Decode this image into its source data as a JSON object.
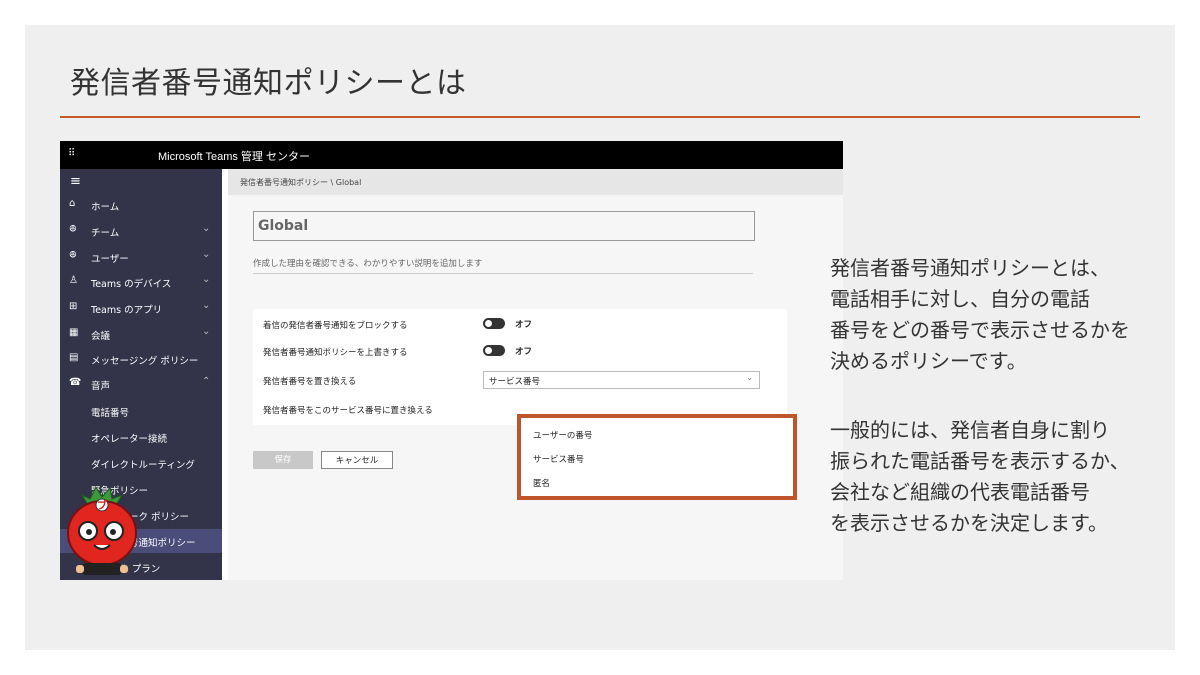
{
  "slide": {
    "title": "発信者番号通知ポリシーとは",
    "paragraph1": [
      "発信者番号通知ポリシーとは、",
      "電話相手に対し、自分の電話",
      "番号をどの番号で表示させるかを",
      "決めるポリシーです。"
    ],
    "paragraph2": [
      "一般的には、発信者自身に割り",
      "振られた電話番号を表示するか、",
      "会社など組織の代表電話番号",
      "を表示させるかを決定します。"
    ]
  },
  "app": {
    "title": "Microsoft Teams 管理 センター",
    "waffle_icon": "⠿",
    "hamburger_icon": "≡"
  },
  "sidebar": {
    "items": [
      {
        "icon": "⌂",
        "label": "ホーム",
        "chevron": ""
      },
      {
        "icon": "ꔮ",
        "label": "チーム",
        "chevron": "⌄"
      },
      {
        "icon": "ꔮ",
        "label": "ユーザー",
        "chevron": "⌄"
      },
      {
        "icon": "♙",
        "label": "Teams のデバイス",
        "chevron": "⌄"
      },
      {
        "icon": "⊞",
        "label": "Teams のアプリ",
        "chevron": "⌄"
      },
      {
        "icon": "▦",
        "label": "会議",
        "chevron": "⌄"
      },
      {
        "icon": "▤",
        "label": "メッセージング ポリシー",
        "chevron": ""
      },
      {
        "icon": "☎",
        "label": "音声",
        "chevron": "⌃"
      }
    ],
    "sub_items": [
      {
        "label": "電話番号"
      },
      {
        "label": "オペレーター接続"
      },
      {
        "label": "ダイレクトルーティング"
      },
      {
        "label": "緊急ポリシー"
      },
      {
        "label": "ネットワーク ポリシー"
      },
      {
        "label": "発信者番号通知ポリシー"
      },
      {
        "label": "ダイヤル プラン"
      }
    ]
  },
  "content": {
    "breadcrumb": "発信者番号通知ポリシー \\ Global",
    "policy_name": "Global",
    "description_placeholder": "作成した理由を確認できる、わかりやすい説明を追加します",
    "settings": [
      {
        "label": "着信の発信者番号通知をブロックする",
        "toggle": "オフ"
      },
      {
        "label": "発信者番号通知ポリシーを上書きする",
        "toggle": "オフ"
      },
      {
        "label": "発信者番号を置き換える",
        "select": "サービス番号"
      },
      {
        "label": "発信者番号をこのサービス番号に置き換える"
      }
    ],
    "dropdown_options": [
      "ユーザーの番号",
      "サービス番号",
      "匿名"
    ],
    "save_label": "保存",
    "cancel_label": "キャンセル"
  },
  "mascot": {
    "badge": "ブ"
  },
  "colors": {
    "accent": "#c55a2b",
    "topbar": "#000000",
    "sidebar": "#33344a",
    "slide_bg": "#efefef"
  }
}
